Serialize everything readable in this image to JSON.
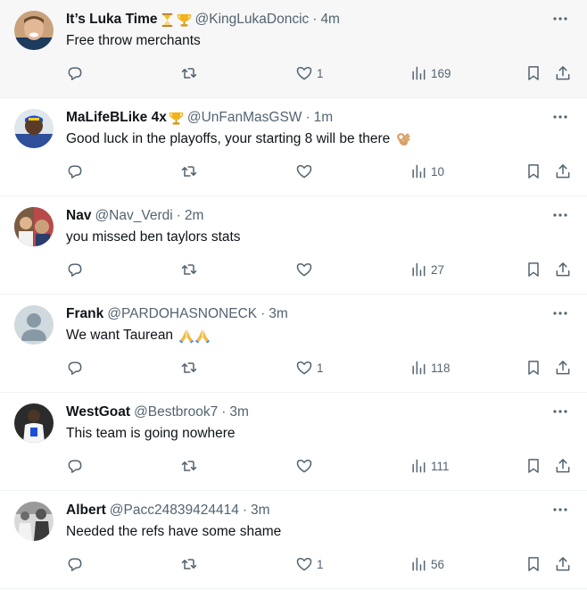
{
  "colors": {
    "text_primary": "#0f1419",
    "text_secondary": "#536471",
    "divider": "#eff3f4",
    "highlight_bg": "#f7f7f7"
  },
  "tweets": [
    {
      "name": "It’s Luka Time",
      "name_emojis": [
        "hourglass-icon",
        "trophy-icon"
      ],
      "handle": "@KingLukaDoncic",
      "dot": "·",
      "time": "4m",
      "text": "Free throw merchants",
      "text_emoji": "",
      "likes": "1",
      "views": "169"
    },
    {
      "name": "MaLifeBLike 4x",
      "name_emojis": [
        "trophy-icon"
      ],
      "handle": "@UnFanMasGSW",
      "dot": "·",
      "time": "1m",
      "text": "Good luck in the playoffs, your starting 8 will be there",
      "text_emoji": "ok-hand-icon",
      "likes": "",
      "views": "10"
    },
    {
      "name": "Nav",
      "name_emojis": [],
      "handle": "@Nav_Verdi",
      "dot": "·",
      "time": "2m",
      "text": "you missed ben taylors stats",
      "text_emoji": "",
      "likes": "",
      "views": "27"
    },
    {
      "name": "Frank",
      "name_emojis": [],
      "handle": "@PARDOHASNONECK",
      "dot": "·",
      "time": "3m",
      "text": "We want Taurean",
      "text_emoji": "praying-hands-icon",
      "likes": "1",
      "views": "118"
    },
    {
      "name": "WestGoat",
      "name_emojis": [],
      "handle": "@Bestbrook7",
      "dot": "·",
      "time": "3m",
      "text": "This team is going nowhere",
      "text_emoji": "",
      "likes": "",
      "views": "111"
    },
    {
      "name": "Albert",
      "name_emojis": [],
      "handle": "@Pacc24839424414",
      "dot": "·",
      "time": "3m",
      "text": "Needed the refs have some shame",
      "text_emoji": "",
      "likes": "1",
      "views": "56"
    }
  ]
}
